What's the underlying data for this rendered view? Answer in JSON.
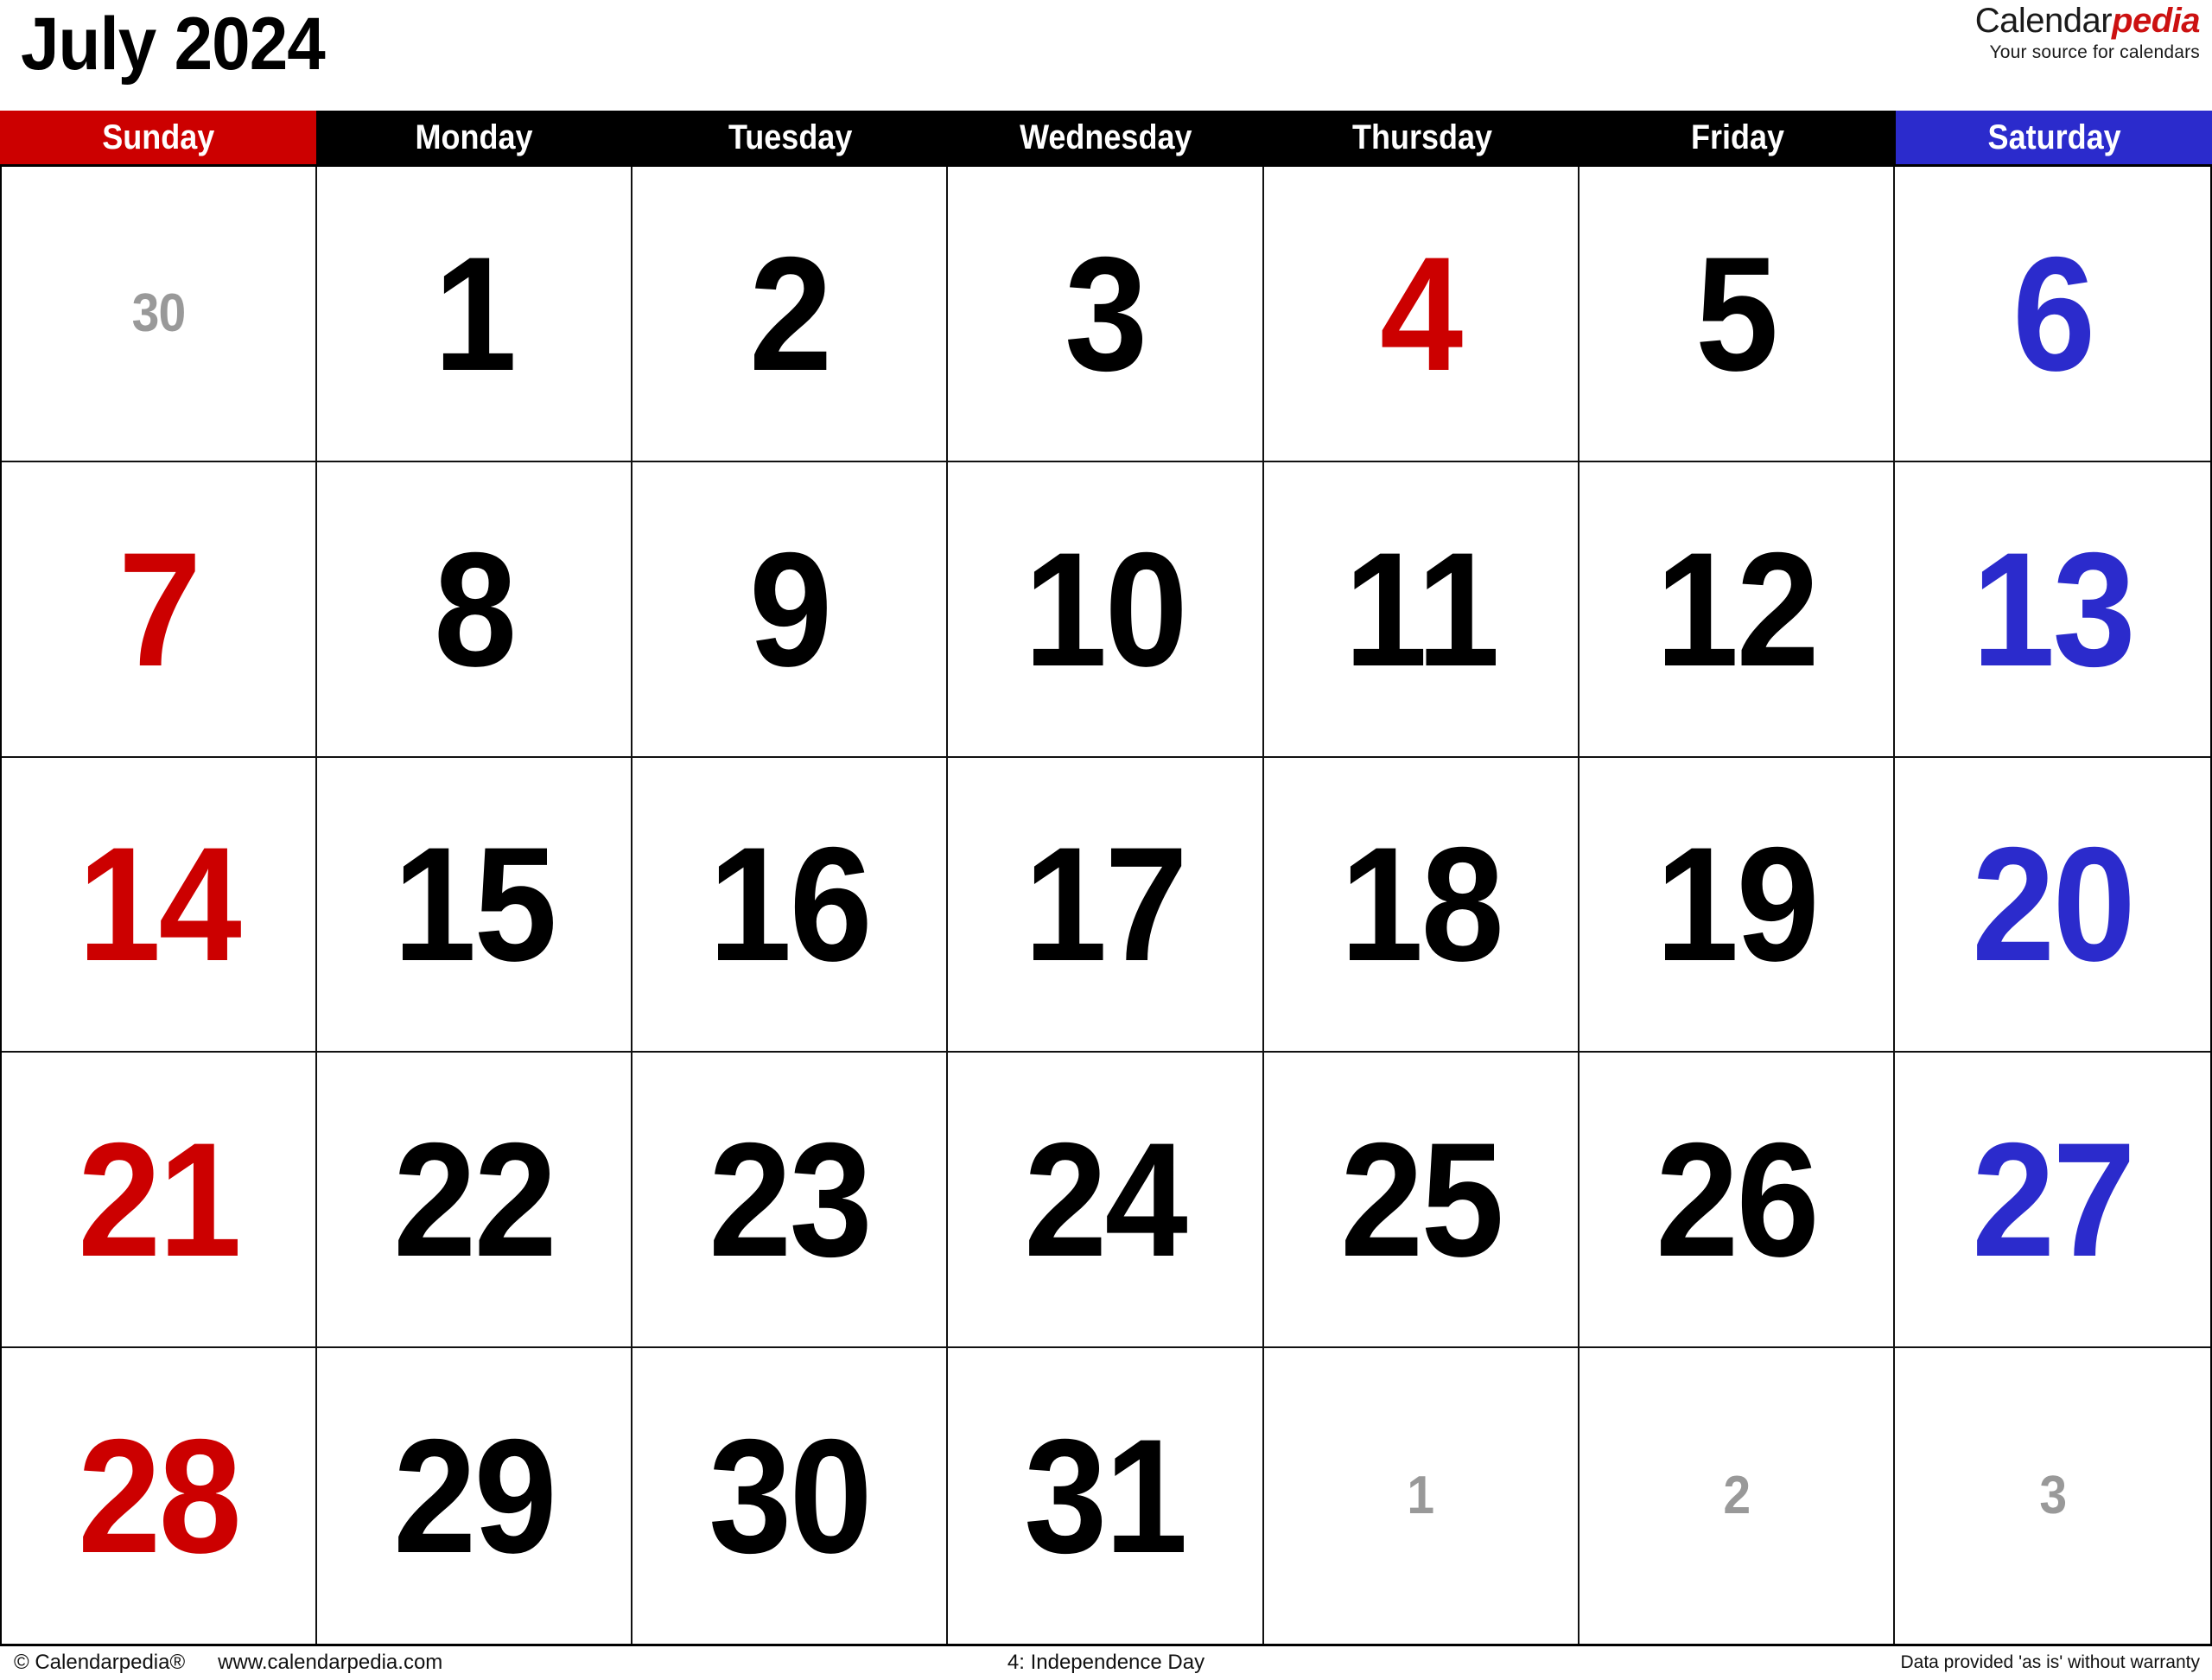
{
  "header": {
    "month_title": "July 2024",
    "brand_name_part1": "Calendar",
    "brand_name_part2": "pedia",
    "brand_tagline": "Your source for calendars"
  },
  "colors": {
    "sunday_red": "#CC0000",
    "saturday_blue": "#2B2BCC",
    "weekday_black": "#000000",
    "out_of_month_grey": "#999999",
    "brand_red": "#CC1111"
  },
  "weekdays": [
    {
      "label": "Sunday",
      "style": "sun"
    },
    {
      "label": "Monday",
      "style": "wd"
    },
    {
      "label": "Tuesday",
      "style": "wd"
    },
    {
      "label": "Wednesday",
      "style": "wd"
    },
    {
      "label": "Thursday",
      "style": "wd"
    },
    {
      "label": "Friday",
      "style": "wd"
    },
    {
      "label": "Saturday",
      "style": "sat"
    }
  ],
  "weeks": [
    [
      {
        "day": "30",
        "kind": "out"
      },
      {
        "day": "1",
        "kind": "wd"
      },
      {
        "day": "2",
        "kind": "wd"
      },
      {
        "day": "3",
        "kind": "wd"
      },
      {
        "day": "4",
        "kind": "holiday"
      },
      {
        "day": "5",
        "kind": "wd"
      },
      {
        "day": "6",
        "kind": "sat"
      }
    ],
    [
      {
        "day": "7",
        "kind": "sun"
      },
      {
        "day": "8",
        "kind": "wd"
      },
      {
        "day": "9",
        "kind": "wd"
      },
      {
        "day": "10",
        "kind": "wd"
      },
      {
        "day": "11",
        "kind": "wd"
      },
      {
        "day": "12",
        "kind": "wd"
      },
      {
        "day": "13",
        "kind": "sat"
      }
    ],
    [
      {
        "day": "14",
        "kind": "sun"
      },
      {
        "day": "15",
        "kind": "wd"
      },
      {
        "day": "16",
        "kind": "wd"
      },
      {
        "day": "17",
        "kind": "wd"
      },
      {
        "day": "18",
        "kind": "wd"
      },
      {
        "day": "19",
        "kind": "wd"
      },
      {
        "day": "20",
        "kind": "sat"
      }
    ],
    [
      {
        "day": "21",
        "kind": "sun"
      },
      {
        "day": "22",
        "kind": "wd"
      },
      {
        "day": "23",
        "kind": "wd"
      },
      {
        "day": "24",
        "kind": "wd"
      },
      {
        "day": "25",
        "kind": "wd"
      },
      {
        "day": "26",
        "kind": "wd"
      },
      {
        "day": "27",
        "kind": "sat"
      }
    ],
    [
      {
        "day": "28",
        "kind": "sun"
      },
      {
        "day": "29",
        "kind": "wd"
      },
      {
        "day": "30",
        "kind": "wd"
      },
      {
        "day": "31",
        "kind": "wd"
      },
      {
        "day": "1",
        "kind": "out"
      },
      {
        "day": "2",
        "kind": "out"
      },
      {
        "day": "3",
        "kind": "out"
      }
    ]
  ],
  "holidays": [
    {
      "label": "4: Independence Day"
    }
  ],
  "footer": {
    "copyright": "© Calendarpedia®",
    "website": "www.calendarpedia.com",
    "center_note": "4: Independence Day",
    "disclaimer": "Data provided 'as is' without warranty"
  }
}
